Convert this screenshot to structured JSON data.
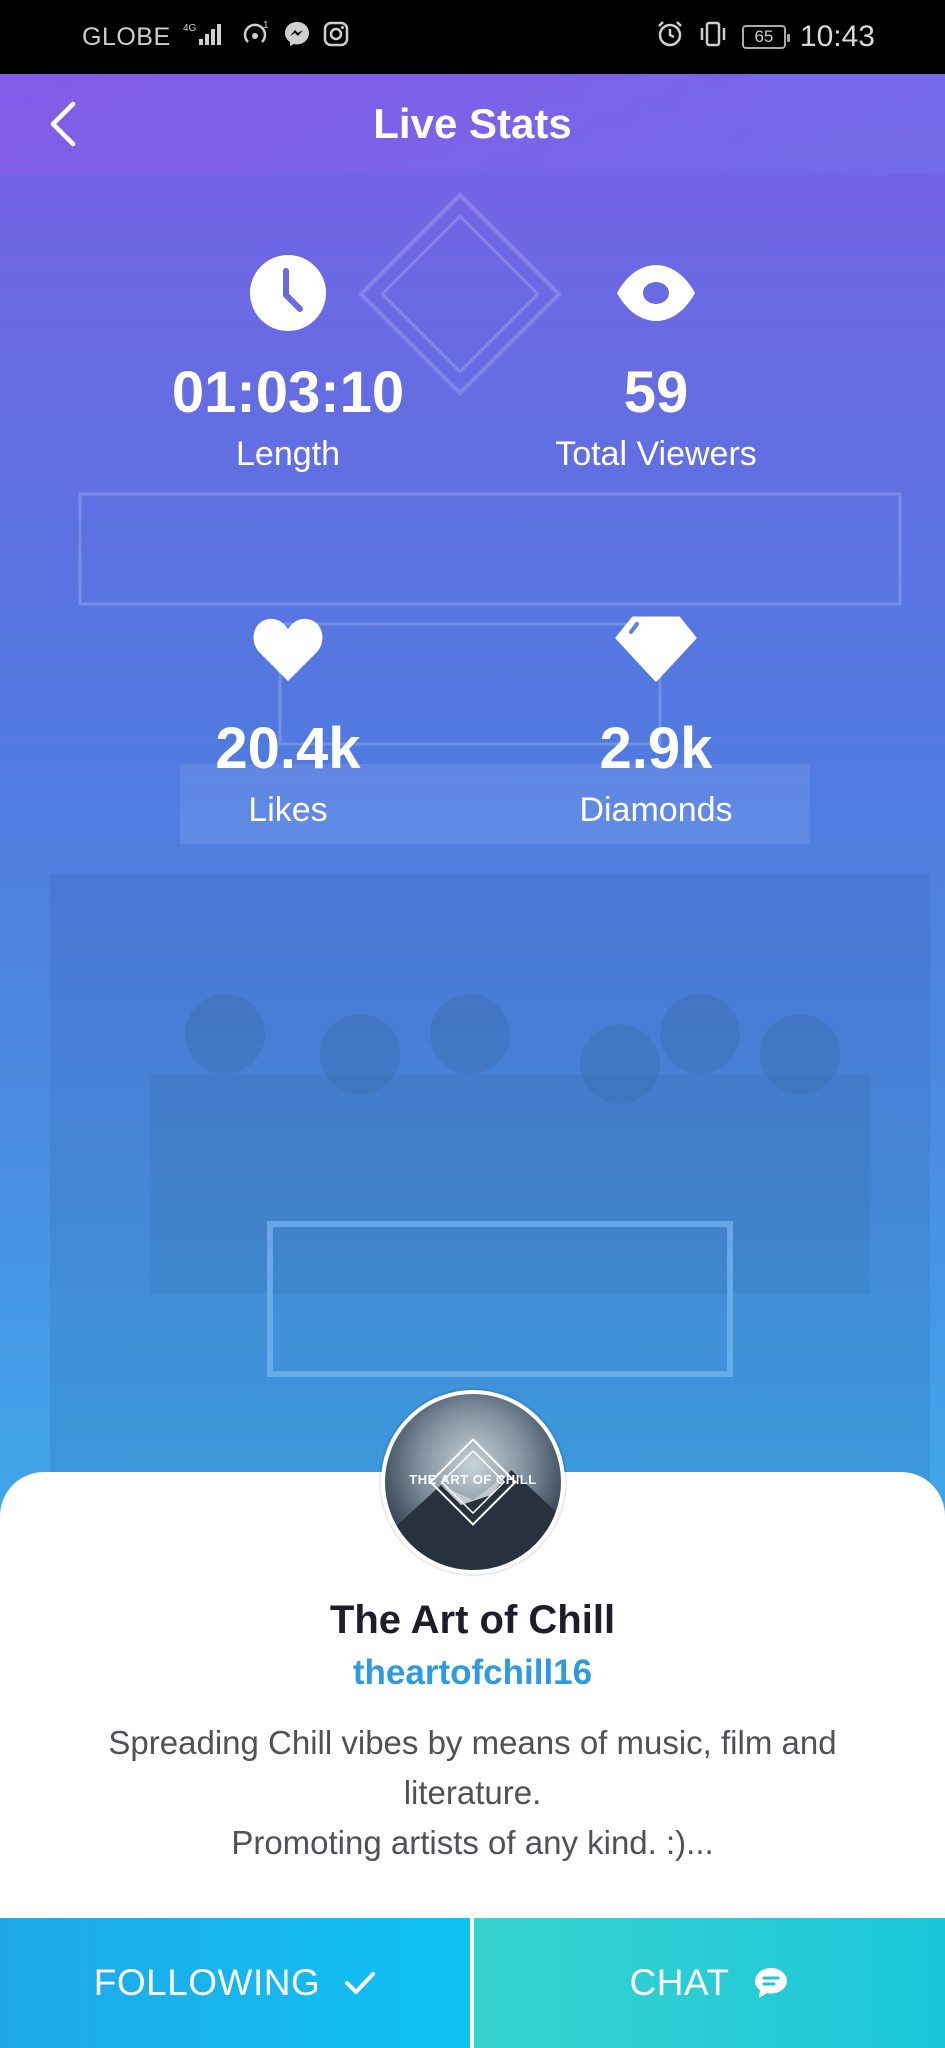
{
  "status_bar": {
    "carrier": "GLOBE",
    "network": "4G",
    "notification_count": "1",
    "battery": "65",
    "time": "10:43"
  },
  "header": {
    "title": "Live Stats"
  },
  "stats": [
    {
      "value": "01:03:10",
      "label": "Length",
      "icon": "clock-icon"
    },
    {
      "value": "59",
      "label": "Total Viewers",
      "icon": "eye-icon"
    },
    {
      "value": "20.4k",
      "label": "Likes",
      "icon": "heart-icon"
    },
    {
      "value": "2.9k",
      "label": "Diamonds",
      "icon": "diamond-icon"
    }
  ],
  "profile": {
    "avatar_text": "THE ART OF CHILL",
    "name": "The Art of Chill",
    "handle": "theartofchill16",
    "bio_line1": "Spreading Chill vibes by means of music, film and literature.",
    "bio_line2": "Promoting artists of any kind. :)..."
  },
  "actions": {
    "following_label": "FOLLOWING",
    "chat_label": "CHAT"
  },
  "colors": {
    "handle": "#2e9ae0",
    "following_button": "#10c2f3",
    "chat_button": "#1bc6da"
  }
}
